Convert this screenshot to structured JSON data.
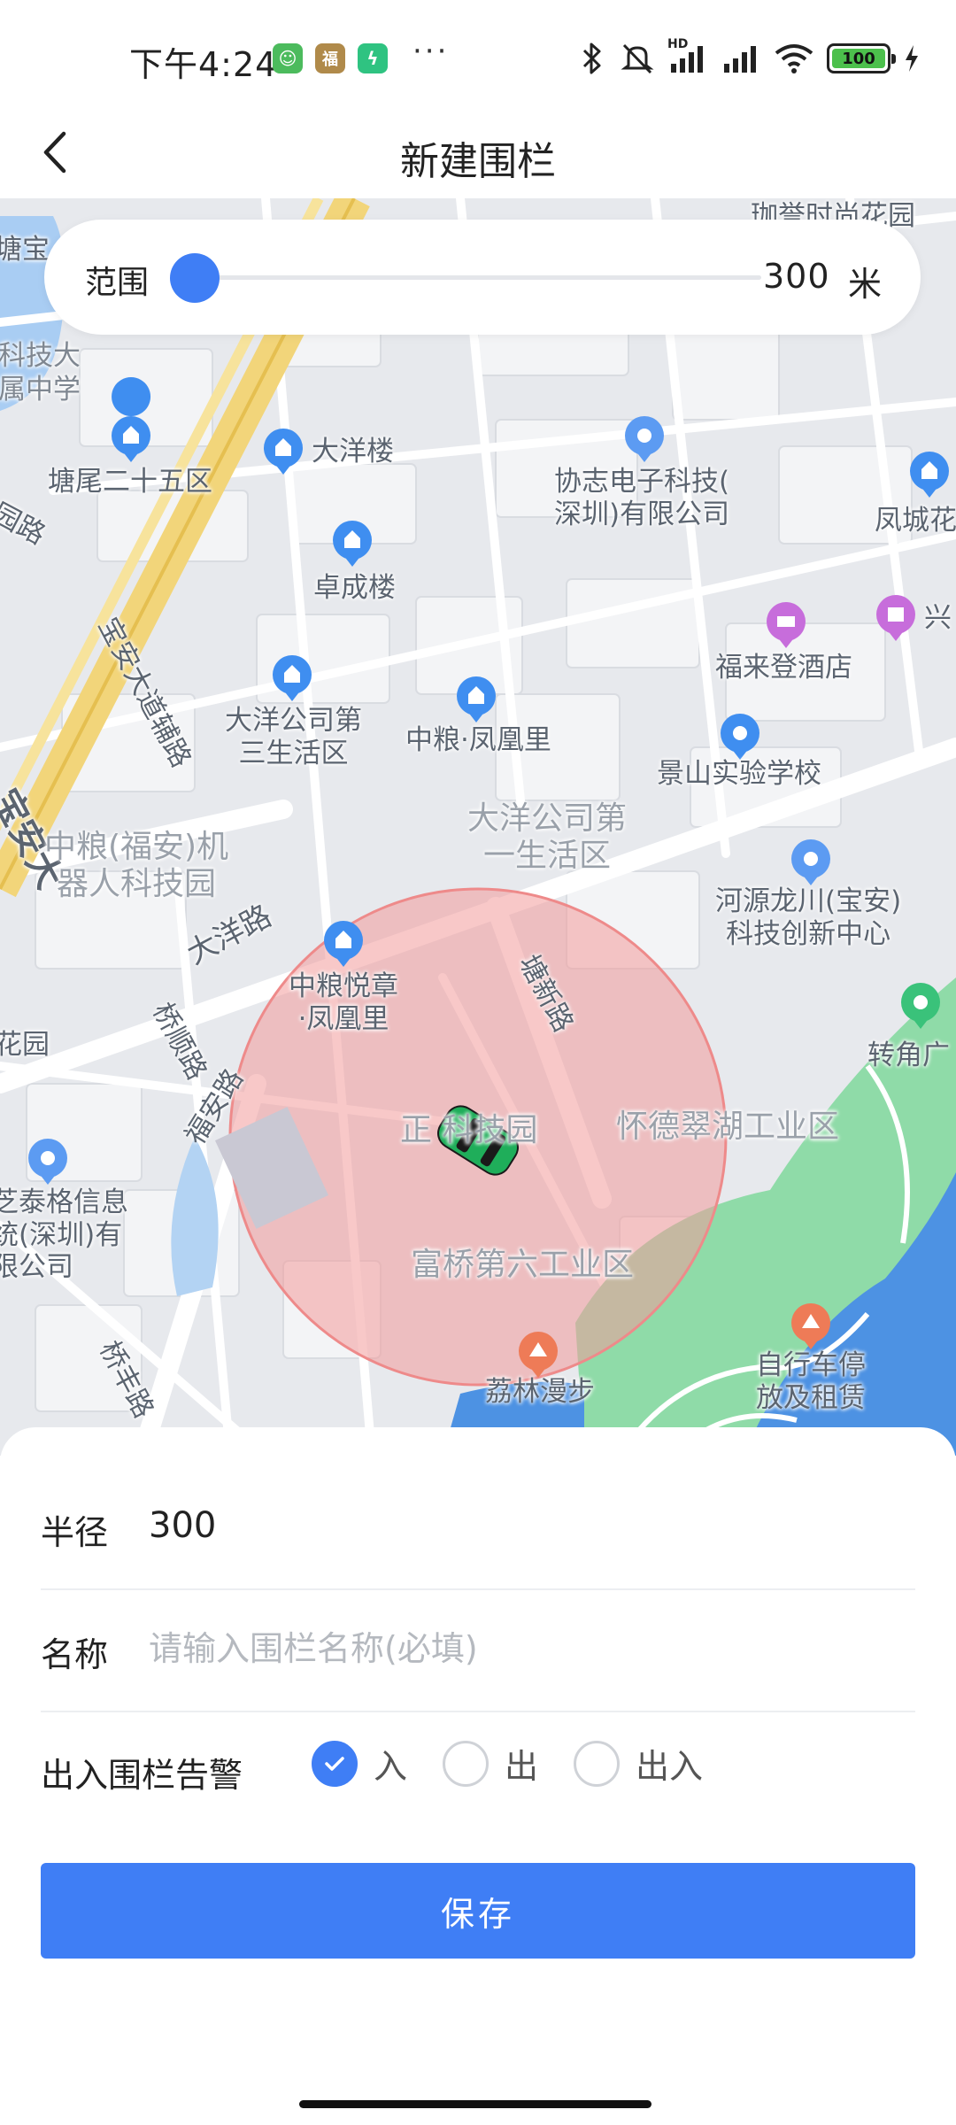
{
  "status_bar": {
    "time": "下午4:24",
    "app_badges": [
      {
        "icon": "smile-app-icon",
        "glyph": "☺",
        "color": "#4cbb5d"
      },
      {
        "icon": "fu-app-icon",
        "glyph": "福",
        "color": "#b08a4a"
      },
      {
        "icon": "bolt-app-icon",
        "glyph": "ϟ",
        "color": "#2fc381"
      }
    ],
    "more": "···",
    "network_label": "HD",
    "battery": "100"
  },
  "header": {
    "title": "新建围栏",
    "back_icon": "chevron-left-icon"
  },
  "range": {
    "label": "范围",
    "value": "300",
    "unit": "米",
    "slider_level": 0
  },
  "map": {
    "labels": {
      "top_right": "珈誉时尚花园",
      "top_left": "塘宝",
      "tech_school_1": "科技大",
      "tech_school_2": "属中学",
      "tangwei": "塘尾二十五区",
      "garden_road": "园路",
      "dayang_lou": "大洋楼",
      "xiezhi": "协志电子科技(\n深圳)有限公司",
      "fengcheng": "凤城花",
      "zhuocheng": "卓成楼",
      "baoan_aux": "宝安大道辅路",
      "fulai": "福来登酒店",
      "xing": "兴",
      "dayang_3": "大洋公司第\n三生活区",
      "zhongliang_fh": "中粮·凤凰里",
      "jingshan": "景山实验学校",
      "baoan_big": "宝安大",
      "zhongliang_robot": "中粮(福安)机\n器人科技园",
      "dayang_1": "大洋公司第\n一生活区",
      "heyuan": "河源龙川(宝安)\n科技创新中心",
      "dayang_road": "大洋路",
      "zhongliang_yz": "中粮悦章\n·凤凰里",
      "tangxin_road": "塘新路",
      "qiaoshun_road": "桥顺路",
      "garden_left": "花园",
      "zhuanjiao": "转角广",
      "fuan_road": "福安路",
      "zhengxin_park": "正 科技园",
      "huaide": "怀德翠湖工业区",
      "zhitai": "芝泰格信息\n统(深圳)有\n限公司",
      "fuqiao_6": "富桥第六工业区",
      "bike": "自行车停\n放及租赁",
      "lilin": "荔林漫步",
      "qiaofeng_road": "桥丰路"
    }
  },
  "form": {
    "radius_label": "半径",
    "radius_value": "300",
    "name_label": "名称",
    "name_placeholder": "请输入围栏名称(必填)",
    "name_value": "",
    "alert_label": "出入围栏告警",
    "alert_options": [
      {
        "label": "入",
        "checked": true
      },
      {
        "label": "出",
        "checked": false
      },
      {
        "label": "出入",
        "checked": false
      }
    ],
    "save_label": "保存"
  },
  "colors": {
    "accent": "#3f7ef5",
    "fence_fill": "#f29a9a",
    "car": "#1fae5a",
    "water": "#9cc6f2",
    "park": "#8fdba8"
  }
}
